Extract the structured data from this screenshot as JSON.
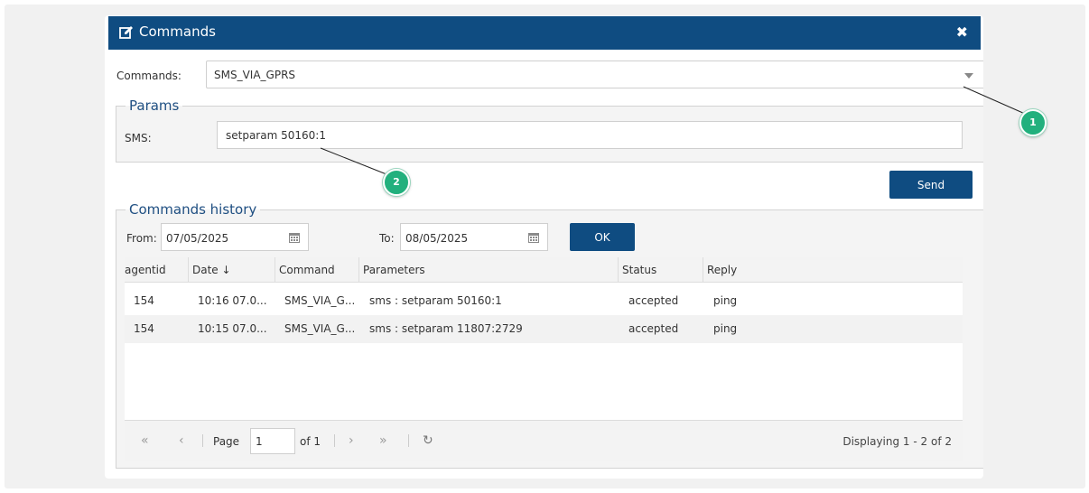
{
  "window": {
    "title": "Commands",
    "close_glyph": "✖"
  },
  "commands": {
    "label": "Commands:",
    "value": "SMS_VIA_GPRS"
  },
  "params": {
    "legend": "Params",
    "sms_label": "SMS:",
    "sms_value": "setparam 50160:1"
  },
  "send_label": "Send",
  "history": {
    "legend": "Commands history",
    "from_label": "From:",
    "from_value": "07/05/2025",
    "to_label": "To:",
    "to_value": "08/05/2025",
    "ok_label": "OK",
    "columns": [
      "agentid",
      "Date ↓",
      "Command",
      "Parameters",
      "Status",
      "Reply"
    ],
    "rows": [
      {
        "agentid": "154",
        "date": "10:16 07.0...",
        "command": "SMS_VIA_G...",
        "parameters": "sms : setparam 50160:1",
        "status": "accepted",
        "reply": "ping"
      },
      {
        "agentid": "154",
        "date": "10:15 07.0...",
        "command": "SMS_VIA_G...",
        "parameters": "sms : setparam 11807:2729",
        "status": "accepted",
        "reply": "ping"
      }
    ]
  },
  "pager": {
    "first": "«",
    "prev": "‹",
    "next": "›",
    "last": "»",
    "refresh": "↻",
    "page_label": "Page",
    "page_value": "1",
    "of_label": "of 1",
    "display": "Displaying 1 - 2 of 2"
  },
  "callouts": {
    "one": "1",
    "two": "2"
  },
  "colors": {
    "header": "#0f4c81",
    "accent_badge": "#22b07d"
  }
}
